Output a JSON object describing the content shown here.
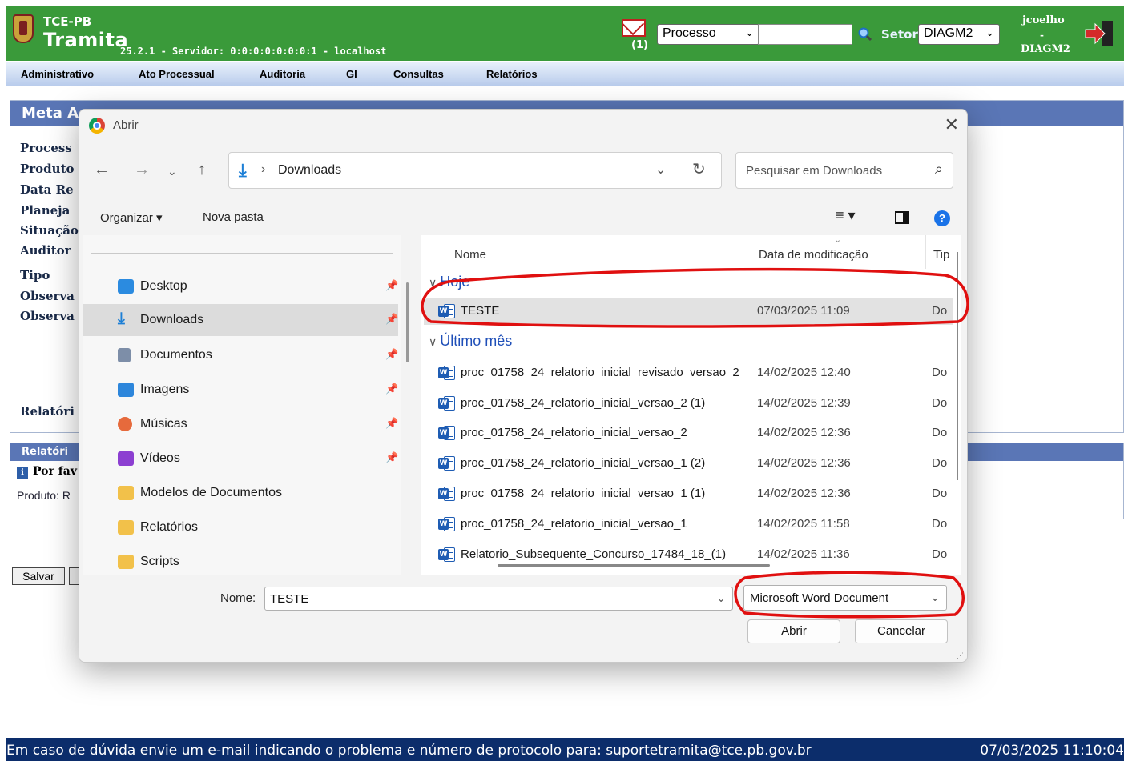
{
  "app": {
    "brand_top": "TCE-PB",
    "brand_main": "Tramita",
    "brand_sub": "25.2.1 - Servidor: 0:0:0:0:0:0:0:1 - localhost",
    "mail_count": "(1)",
    "process_select": "Processo",
    "setor_label": "Setor",
    "setor_select": "DIAGM2",
    "user_name": "jcoelho",
    "user_dash": "-",
    "user_setor": "DIAGM2",
    "colors": {
      "header_bg": "#3a9a3a",
      "panel_title_bg": "#5a76b6",
      "footer_bg": "#0c2d6b"
    }
  },
  "menu": {
    "items": [
      "Administrativo",
      "Ato Processual",
      "Auditoria",
      "GI",
      "Consultas",
      "Relatórios"
    ]
  },
  "meta": {
    "title": "Meta A",
    "fields": [
      "Process",
      "Produto",
      "Data Re",
      "Planeja",
      "Situação",
      "Auditor",
      "Tipo",
      "Observa",
      "Observa",
      "Relatóri"
    ]
  },
  "relatorio": {
    "title": "Relatóri",
    "info": "Por fav",
    "produto": "Produto: R"
  },
  "buttons": {
    "salvar": "Salvar"
  },
  "footer": {
    "message": "Em caso de dúvida envie um e-mail indicando o problema e número de protocolo para: suportetramita@tce.pb.gov.br",
    "datetime": "07/03/2025 11:10:04"
  },
  "dialog": {
    "title": "Abrir",
    "address": "Downloads",
    "search_placeholder": "Pesquisar em Downloads",
    "toolbar": {
      "organize": "Organizar ▾",
      "new_folder": "Nova pasta"
    },
    "nav_items": [
      {
        "label": "Desktop",
        "icon": "desktop-icon",
        "pinned": true
      },
      {
        "label": "Downloads",
        "icon": "downloads-icon",
        "pinned": true,
        "selected": true
      },
      {
        "label": "Documentos",
        "icon": "documents-icon",
        "pinned": true
      },
      {
        "label": "Imagens",
        "icon": "pictures-icon",
        "pinned": true
      },
      {
        "label": "Músicas",
        "icon": "music-icon",
        "pinned": true
      },
      {
        "label": "Vídeos",
        "icon": "videos-icon",
        "pinned": true
      },
      {
        "label": "Modelos de Documentos",
        "icon": "folder-icon",
        "pinned": false
      },
      {
        "label": "Relatórios",
        "icon": "folder-icon",
        "pinned": false
      },
      {
        "label": "Scripts",
        "icon": "folder-icon",
        "pinned": false
      }
    ],
    "columns": {
      "name": "Nome",
      "date": "Data de modificação",
      "type": "Tip"
    },
    "groups": [
      {
        "label": "Hoje",
        "files": [
          {
            "name": "TESTE",
            "date": "07/03/2025 11:09",
            "type": "Do",
            "selected": true
          }
        ]
      },
      {
        "label": "Último mês",
        "files": [
          {
            "name": "proc_01758_24_relatorio_inicial_revisado_versao_2",
            "date": "14/02/2025 12:40",
            "type": "Do"
          },
          {
            "name": "proc_01758_24_relatorio_inicial_versao_2 (1)",
            "date": "14/02/2025 12:39",
            "type": "Do"
          },
          {
            "name": "proc_01758_24_relatorio_inicial_versao_2",
            "date": "14/02/2025 12:36",
            "type": "Do"
          },
          {
            "name": "proc_01758_24_relatorio_inicial_versao_1 (2)",
            "date": "14/02/2025 12:36",
            "type": "Do"
          },
          {
            "name": "proc_01758_24_relatorio_inicial_versao_1 (1)",
            "date": "14/02/2025 12:36",
            "type": "Do"
          },
          {
            "name": "proc_01758_24_relatorio_inicial_versao_1",
            "date": "14/02/2025 11:58",
            "type": "Do"
          },
          {
            "name": "Relatorio_Subsequente_Concurso_17484_18_(1)",
            "date": "14/02/2025 11:36",
            "type": "Do"
          }
        ]
      }
    ],
    "name_label": "Nome:",
    "name_value": "TESTE",
    "file_type": "Microsoft Word Document",
    "open_label": "Abrir",
    "cancel_label": "Cancelar",
    "annotation_color": "#e01010"
  }
}
